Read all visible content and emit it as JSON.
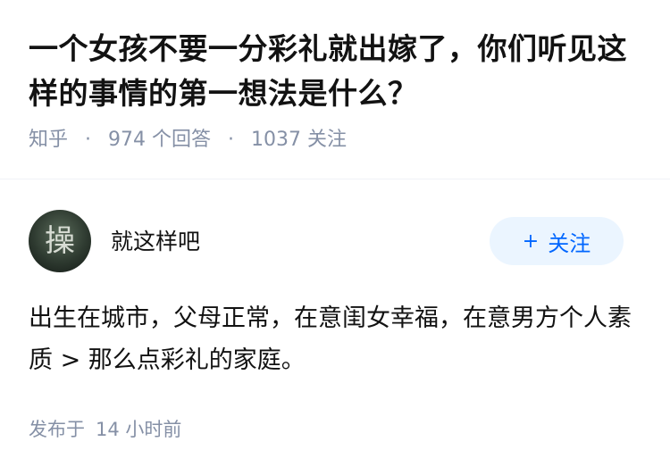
{
  "question": {
    "title": "一个女孩不要一分彩礼就出嫁了，你们听见这样的事情的第一想法是什么？",
    "source": "知乎",
    "answers_count": "974",
    "answers_label": "个回答",
    "followers_count": "1037",
    "followers_label": "关注"
  },
  "author": {
    "name": "就这样吧",
    "avatar_text": "操",
    "follow_plus": "+",
    "follow_label": "关注"
  },
  "answer": {
    "text": "出生在城市，父母正常，在意闺女幸福，在意男方个人素质 > 那么点彩礼的家庭。"
  },
  "publish": {
    "label": "发布于",
    "time": "14 小时前"
  },
  "colors": {
    "meta_gray": "#8590a6",
    "follow_blue": "#0066ff",
    "follow_bg": "#ebf5ff"
  }
}
